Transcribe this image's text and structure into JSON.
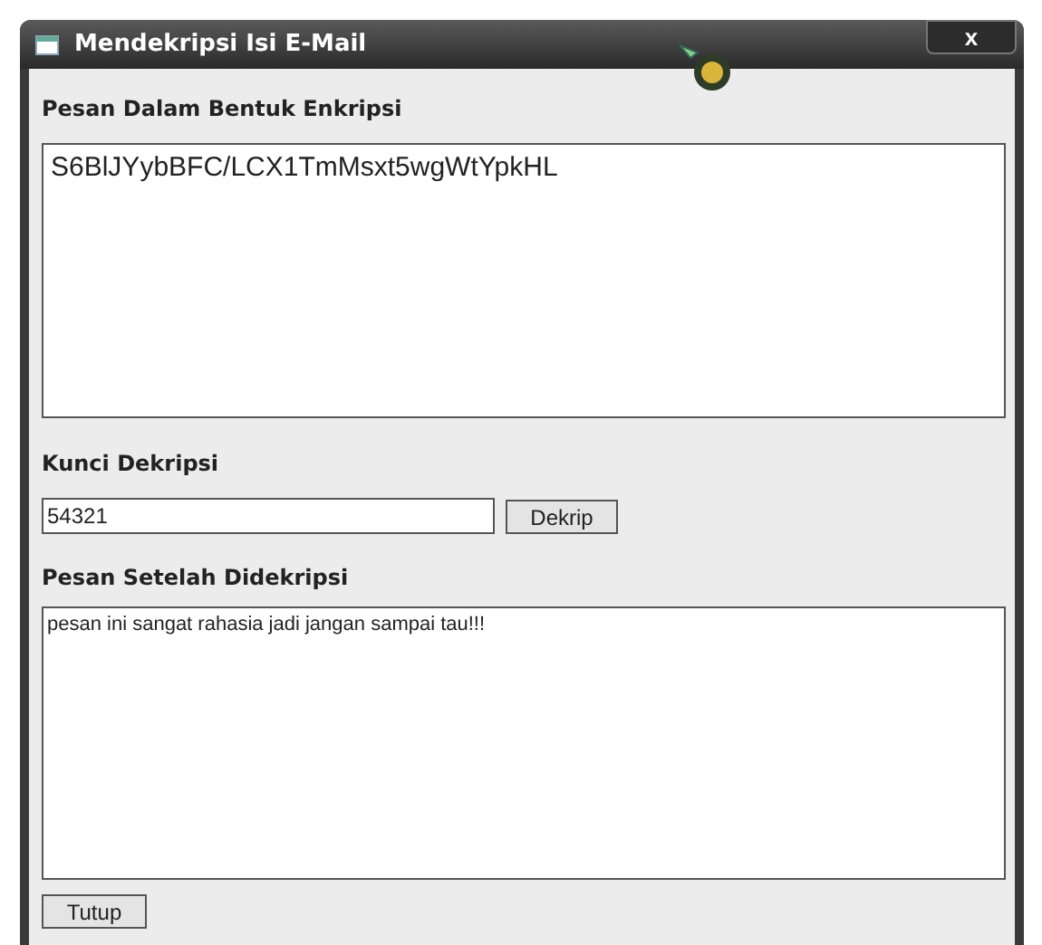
{
  "window": {
    "title": "Mendekripsi Isi E-Mail",
    "close": "x"
  },
  "encrypted": {
    "label": "Pesan Dalam Bentuk Enkripsi",
    "value": "S6BlJYybBFC/LCX1TmMsxt5wgWtYpkHL"
  },
  "key": {
    "label": "Kunci Dekripsi",
    "value": "54321",
    "button": "Dekrip"
  },
  "decrypted": {
    "label": "Pesan Setelah Didekripsi",
    "value": "pesan ini sangat rahasia jadi jangan sampai tau!!!"
  },
  "buttons": [
    "Tutup"
  ]
}
